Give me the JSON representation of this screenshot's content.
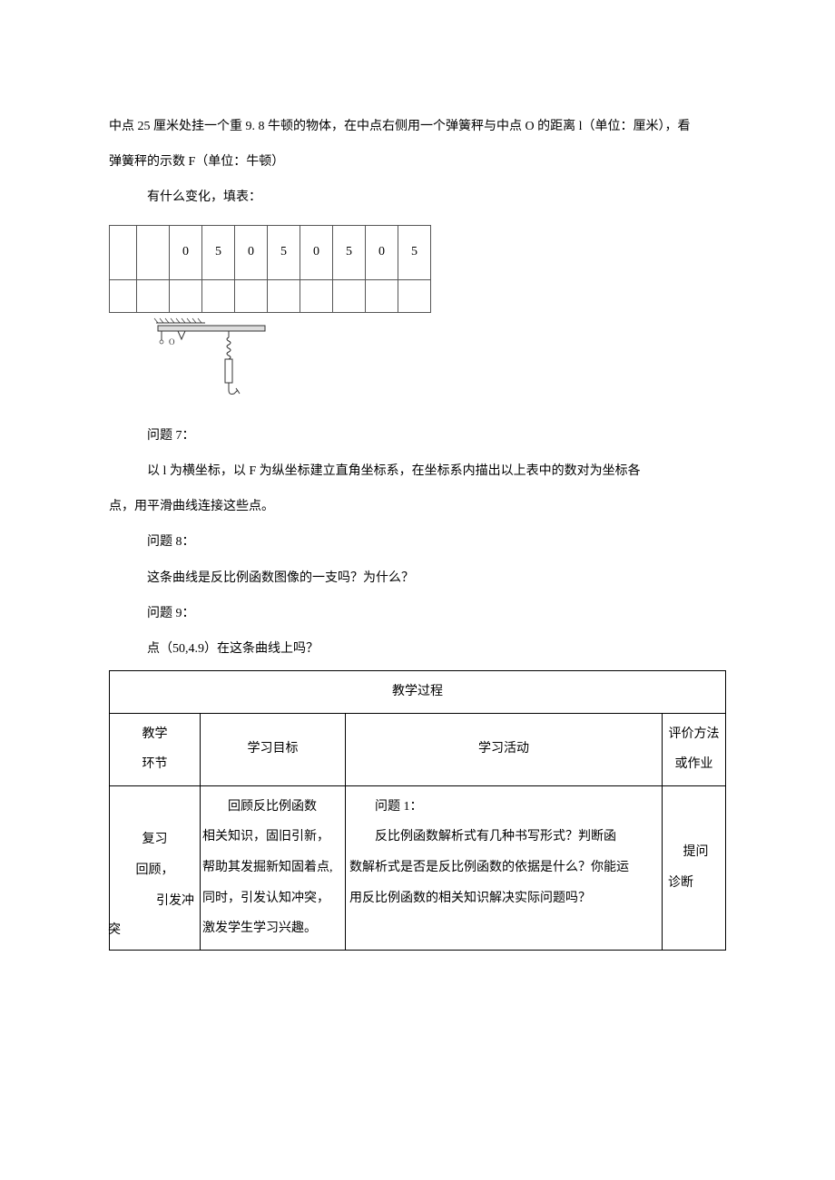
{
  "intro": {
    "line1": "中点 25 厘米处挂一个重 9. 8 牛顿的物体，在中点右侧用一个弹簧秤与中点 O 的距离 l（单位：厘米），看",
    "line2": "弹簧秤的示数 F（单位：牛顿）",
    "line3": "有什么变化，填表："
  },
  "small_table": {
    "row1": [
      "",
      "",
      "0",
      "5",
      "0",
      "5",
      "0",
      "5",
      "0",
      "5"
    ],
    "row2": [
      "",
      "",
      "",
      "",
      "",
      "",
      "",
      "",
      "",
      ""
    ]
  },
  "questions": {
    "q7_title": "问题 7：",
    "q7_line1": "以 l 为横坐标，以 F 为纵坐标建立直角坐标系，在坐标系内描出以上表中的数对为坐标各",
    "q7_line2": "点，用平滑曲线连接这些点。",
    "q8_title": "问题 8：",
    "q8_text": "这条曲线是反比例函数图像的一支吗？为什么？",
    "q9_title": "问题 9：",
    "q9_text": "点（50,4.9）在这条曲线上吗？"
  },
  "main_table": {
    "title": "教学过程",
    "header": {
      "col1_line1": "教学",
      "col1_line2": "环节",
      "col2": "学习目标",
      "col3": "学习活动",
      "col4_line1": "评价方法",
      "col4_line2": "或作业"
    },
    "row1": {
      "col1_a": "复习",
      "col1_b": "回顾，",
      "col1_c": "引发冲",
      "col1_d": "突",
      "col2_a": "回顾反比例函数",
      "col2_b": "相关知识，固旧引新，",
      "col2_c": "帮助其发掘新知固着点,",
      "col2_d": "同时，引发认知冲突，",
      "col2_e": "激发学生学习兴趣。",
      "col3_title": "问题 1：",
      "col3_a": "反比例函数解析式有几种书写形式？判断函",
      "col3_b": "数解析式是否是反比例函数的依据是什么？你能运",
      "col3_c": "用反比例函数的相关知识解决实际问题吗？",
      "col4_line1": "提问",
      "col4_line2": "诊断"
    }
  }
}
